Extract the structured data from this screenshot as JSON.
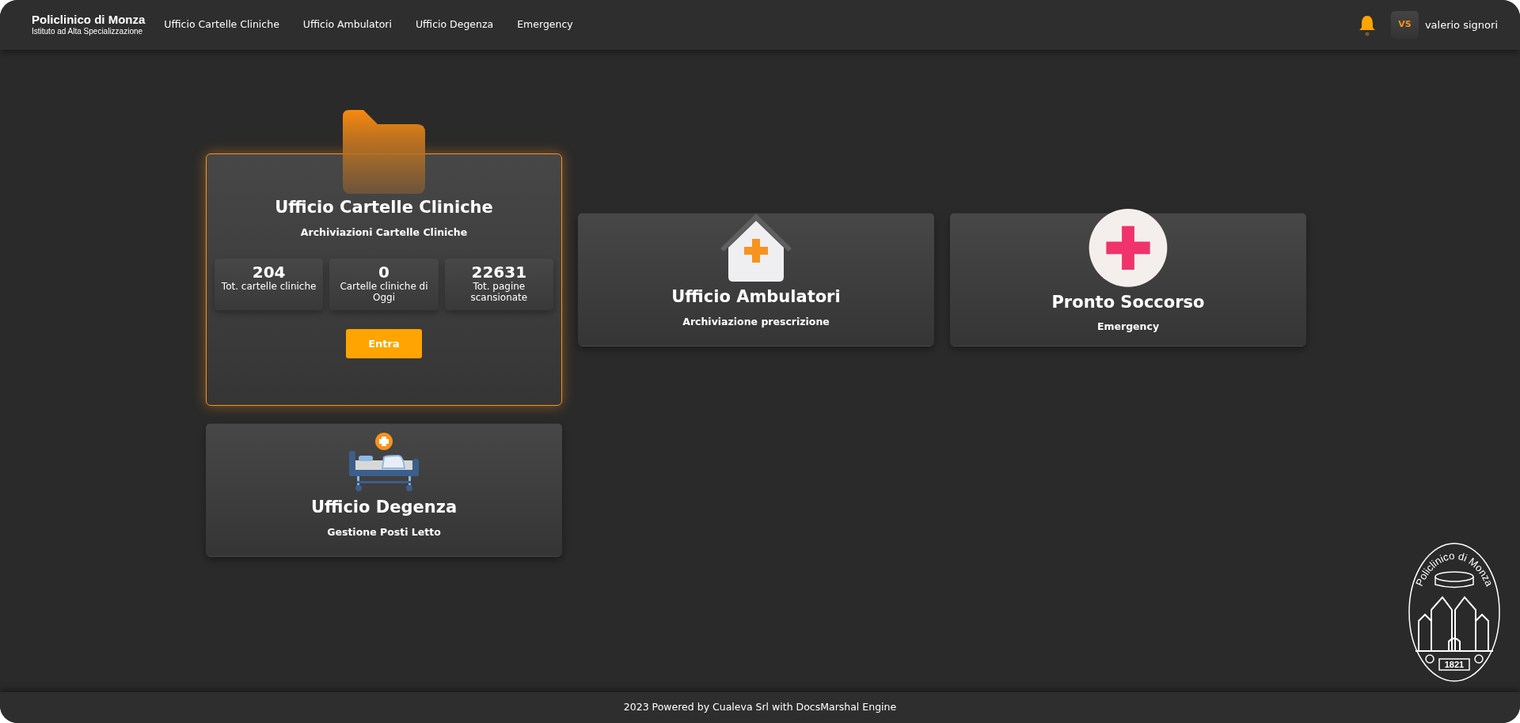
{
  "navbar": {
    "brand": "Policlinico di Monza",
    "tagline": "Istituto ad Alta Specializzazione",
    "links": [
      "Ufficio Cartelle Cliniche",
      "Ufficio Ambulatori",
      "Ufficio Degenza",
      "Emergency"
    ],
    "user": {
      "initials": "VS",
      "name": "valerio signori"
    }
  },
  "cards": [
    {
      "kind": "folder",
      "title": "Ufficio Cartelle Cliniche",
      "subtitle": "Archiviazioni Cartelle Cliniche",
      "selected": true,
      "stats": [
        {
          "value": "204",
          "label": "Tot. cartelle cliniche"
        },
        {
          "value": "0",
          "label": "Cartelle cliniche di Oggi"
        },
        {
          "value": "22631",
          "label": "Tot. pagine scansionate"
        }
      ],
      "button": "Entra"
    },
    {
      "kind": "clinic",
      "title": "Ufficio Ambulatori",
      "subtitle": "Archiviazione prescrizione",
      "selected": false
    },
    {
      "kind": "emergency",
      "title": "Pronto Soccorso",
      "subtitle": "Emergency",
      "selected": false
    },
    {
      "kind": "bed",
      "title": "Ufficio Degenza",
      "subtitle": "Gestione Posti Letto",
      "selected": false
    }
  ],
  "logo": {
    "arc_text": "Policlinico di Monza",
    "year": "1821"
  },
  "footer": "2023 Powered by Cualeva Srl with DocsMarshal Engine"
}
